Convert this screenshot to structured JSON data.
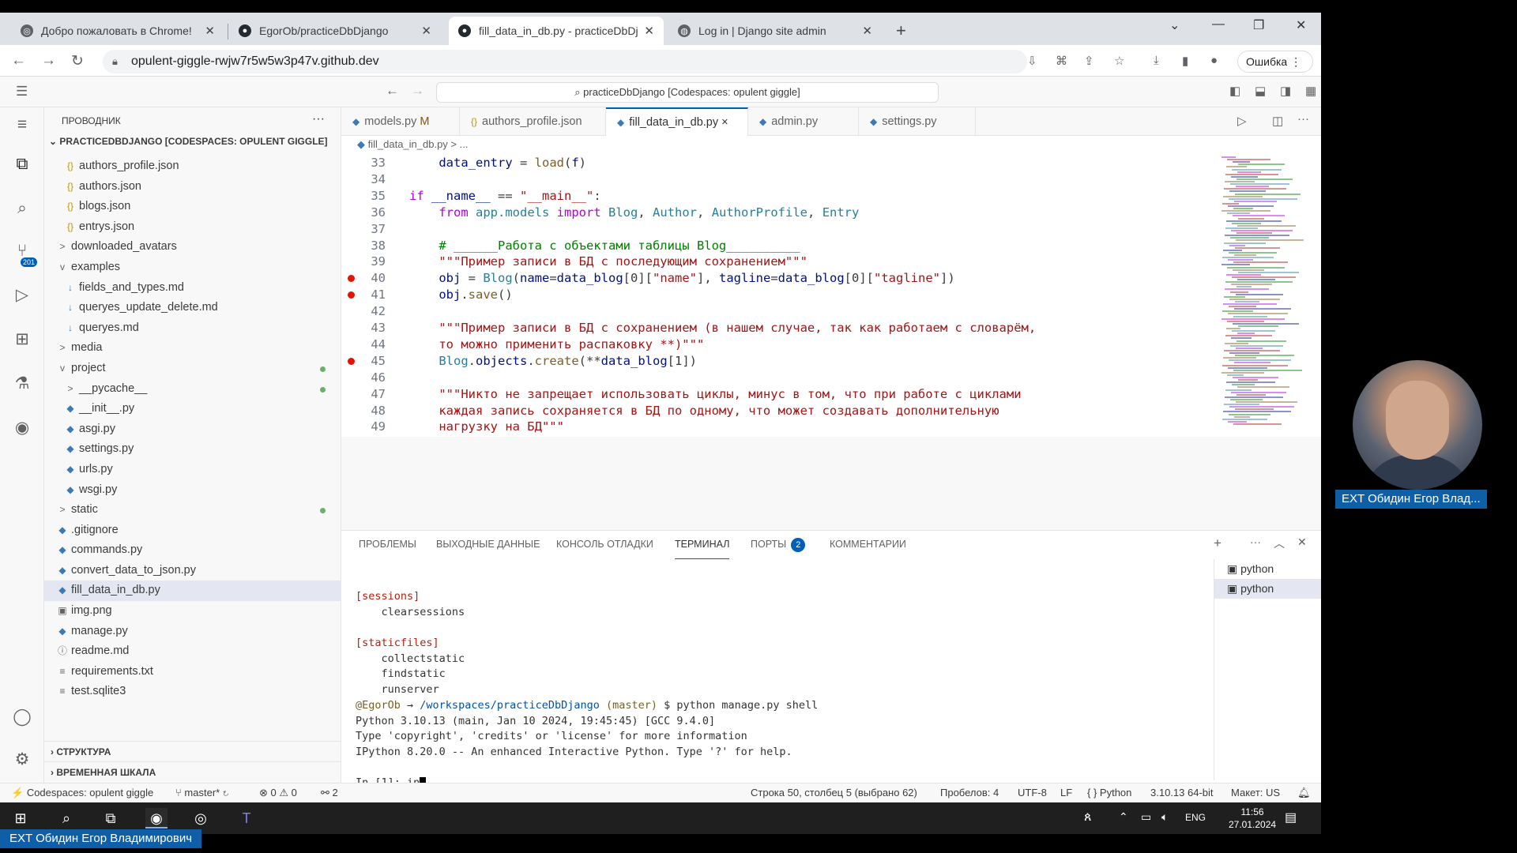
{
  "browser": {
    "tabs": [
      {
        "title": "Добро пожаловать в Chrome!"
      },
      {
        "title": "EgorOb/practiceDbDjango"
      },
      {
        "title": "fill_data_in_db.py - practiceDbDjango"
      },
      {
        "title": "Log in | Django site admin"
      }
    ],
    "url": "opulent-giggle-rwjw7r5w5w3p47v.github.dev",
    "error_button": "Ошибка"
  },
  "vscode": {
    "command_center": "practiceDbDjango [Codespaces: opulent giggle]",
    "scm_badge": "201",
    "explorer": {
      "header": "ПРОВОДНИК",
      "project": "PRACTICEDBDJANGO [CODESPACES: OPULENT GIGGLE]",
      "items": [
        {
          "label": "authors_profile.json",
          "icon": "{}",
          "indent": 1
        },
        {
          "label": "authors.json",
          "icon": "{}",
          "indent": 1
        },
        {
          "label": "blogs.json",
          "icon": "{}",
          "indent": 1
        },
        {
          "label": "entrys.json",
          "icon": "{}",
          "indent": 1
        },
        {
          "label": "downloaded_avatars",
          "icon": ">",
          "indent": 0
        },
        {
          "label": "examples",
          "icon": "v",
          "indent": 0
        },
        {
          "label": "fields_and_types.md",
          "icon": "↓",
          "indent": 1
        },
        {
          "label": "queryes_update_delete.md",
          "icon": "↓",
          "indent": 1
        },
        {
          "label": "queryes.md",
          "icon": "↓",
          "indent": 1
        },
        {
          "label": "media",
          "icon": ">",
          "indent": 0
        },
        {
          "label": "project",
          "icon": "v",
          "indent": 0,
          "dot": true
        },
        {
          "label": "__pycache__",
          "icon": ">",
          "indent": 1,
          "dot": true
        },
        {
          "label": "__init__.py",
          "icon": "◆",
          "indent": 1
        },
        {
          "label": "asgi.py",
          "icon": "◆",
          "indent": 1
        },
        {
          "label": "settings.py",
          "icon": "◆",
          "indent": 1
        },
        {
          "label": "urls.py",
          "icon": "◆",
          "indent": 1
        },
        {
          "label": "wsgi.py",
          "icon": "◆",
          "indent": 1
        },
        {
          "label": "static",
          "icon": ">",
          "indent": 0,
          "dot": true
        },
        {
          "label": ".gitignore",
          "icon": "◆",
          "indent": 0
        },
        {
          "label": "commands.py",
          "icon": "◆",
          "indent": 0
        },
        {
          "label": "convert_data_to_json.py",
          "icon": "◆",
          "indent": 0
        },
        {
          "label": "fill_data_in_db.py",
          "icon": "◆",
          "indent": 0,
          "selected": true
        },
        {
          "label": "img.png",
          "icon": "▣",
          "indent": 0
        },
        {
          "label": "manage.py",
          "icon": "◆",
          "indent": 0
        },
        {
          "label": "readme.md",
          "icon": "ⓘ",
          "indent": 0
        },
        {
          "label": "requirements.txt",
          "icon": "≡",
          "indent": 0
        },
        {
          "label": "test.sqlite3",
          "icon": "≡",
          "indent": 0
        }
      ],
      "outline": "СТРУКТУРА",
      "timeline": "ВРЕМЕННАЯ ШКАЛА"
    },
    "editor_tabs": [
      {
        "label": "models.py",
        "suffix": "M"
      },
      {
        "label": "authors_profile.json",
        "suffix": ""
      },
      {
        "label": "fill_data_in_db.py",
        "suffix": "×"
      },
      {
        "label": "admin.py",
        "suffix": ""
      },
      {
        "label": "settings.py",
        "suffix": ""
      }
    ],
    "breadcrumb": "fill_data_in_db.py  >  ...",
    "code_lines": [
      {
        "n": "33",
        "html": "    <span class='v'>data_entry</span> = <span class='f'>load</span>(<span class='v'>f</span>)"
      },
      {
        "n": "34",
        "html": ""
      },
      {
        "n": "35",
        "html": "<span class='k'>if</span> <span class='v'>__name__</span> == <span class='s'>\"__main__\"</span>:"
      },
      {
        "n": "36",
        "html": "    <span class='k'>from</span> <span class='t'>app.models</span> <span class='k'>import</span> <span class='t'>Blog</span>, <span class='t'>Author</span>, <span class='t'>AuthorProfile</span>, <span class='t'>Entry</span>"
      },
      {
        "n": "37",
        "html": ""
      },
      {
        "n": "38",
        "html": "    <span class='c'># ______Работа с объектами таблицы Blog__________</span>"
      },
      {
        "n": "39",
        "html": "    <span class='s'>\"\"\"Пример записи в БД с последующим сохранением\"\"\"</span>"
      },
      {
        "n": "40",
        "html": "    <span class='v'>obj</span> = <span class='t'>Blog</span>(<span class='v'>name</span>=<span class='v'>data_blog</span>[0][<span class='s'>\"name\"</span>], <span class='v'>tagline</span>=<span class='v'>data_blog</span>[0][<span class='s'>\"tagline\"</span>])",
        "bp": true
      },
      {
        "n": "41",
        "html": "    <span class='v'>obj</span>.<span class='f'>save</span>()",
        "bp": true
      },
      {
        "n": "42",
        "html": ""
      },
      {
        "n": "43",
        "html": "    <span class='s'>\"\"\"Пример записи в БД с сохранением (в нашем случае, так как работаем с словарём,</span>"
      },
      {
        "n": "44",
        "html": "<span class='s'>    то можно применить распаковку **)\"\"\"</span>"
      },
      {
        "n": "45",
        "html": "    <span class='t'>Blog</span>.<span class='v'>objects</span>.<span class='f'>create</span>(**<span class='v'>data_blog</span>[1])",
        "bp": true
      },
      {
        "n": "46",
        "html": ""
      },
      {
        "n": "47",
        "html": "    <span class='s'>\"\"\"Никто не запрещает использовать циклы, минус в том, что при работе с циклами</span>"
      },
      {
        "n": "48",
        "html": "<span class='s'>    каждая запись сохраняется в БД по одному, что может создавать дополнительную</span>"
      },
      {
        "n": "49",
        "html": "<span class='s'>    нагрузку на БД\"\"\"</span>"
      }
    ],
    "panel_tabs": [
      "ПРОБЛЕМЫ",
      "ВЫХОДНЫЕ ДАННЫЕ",
      "КОНСОЛЬ ОТЛАДКИ",
      "ТЕРМИНАЛ",
      "ПОРТЫ",
      "КОММЕНТАРИИ"
    ],
    "ports_count": "2",
    "terminal_lines": [
      {
        "html": "<span class='ty'>[sessions]</span>"
      },
      {
        "html": "    clearsessions"
      },
      {
        "html": ""
      },
      {
        "html": "<span class='ty'>[staticfiles]</span>"
      },
      {
        "html": "    collectstatic"
      },
      {
        "html": "    findstatic"
      },
      {
        "html": "    runserver"
      },
      {
        "html": "<span class='tp'>@EgorOb</span> → <span class='tg'>/workspaces/practiceDbDjango</span> <span class='tp'>(master)</span> $ python manage.py shell"
      },
      {
        "html": "Python 3.10.13 (main, Jan 10 2024, 19:45:45) [GCC 9.4.0]"
      },
      {
        "html": "Type 'copyright', 'credits' or 'license' for more information"
      },
      {
        "html": "IPython 8.20.0 -- An enhanced Interactive Python. Type '?' for help."
      },
      {
        "html": ""
      }
    ],
    "prompt": "In [1]: in",
    "terminal_list": [
      "python",
      "python"
    ],
    "status": {
      "remote": "Codespaces: opulent giggle",
      "branch": "master*",
      "problems": "⊗ 0 ⚠ 0",
      "ports": "2",
      "position": "Строка 50, столбец 5 (выбрано 62)",
      "spaces": "Пробелов: 4",
      "encoding": "UTF-8",
      "eol": "LF",
      "language": "Python",
      "interpreter": "3.10.13 64-bit",
      "layout": "Макет: US"
    }
  },
  "taskbar": {
    "lang": "ENG",
    "time": "11:56",
    "date": "27.01.2024"
  },
  "overlay": {
    "cam_label": "EXT Обидин Егор Влад...",
    "bottom_label": "EXT Обидин Егор Владимирович"
  }
}
